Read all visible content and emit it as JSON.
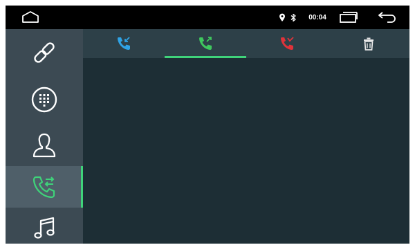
{
  "status_bar": {
    "time": "00:04",
    "icons": [
      "home-icon",
      "location-pin-icon",
      "bluetooth-icon",
      "recent-apps-icon",
      "back-icon"
    ]
  },
  "sidebar": {
    "items": [
      {
        "icon": "link-icon",
        "active": false
      },
      {
        "icon": "dialpad-icon",
        "active": false
      },
      {
        "icon": "contacts-icon",
        "active": false
      },
      {
        "icon": "call-log-icon",
        "active": true
      },
      {
        "icon": "music-icon",
        "active": false
      }
    ]
  },
  "tabs": [
    {
      "icon": "incoming-call-icon",
      "color": "#2fa3e6",
      "selected": false
    },
    {
      "icon": "outgoing-call-icon",
      "color": "#3fc85e",
      "selected": true
    },
    {
      "icon": "missed-call-icon",
      "color": "#e0333a",
      "selected": false
    },
    {
      "icon": "trash-icon",
      "color": "#e8e8e8",
      "selected": false
    }
  ],
  "colors": {
    "accent": "#3fd37a",
    "status_bar": "#000000",
    "sidebar": "#3c4a53",
    "tab_bar": "#2d4048",
    "content": "#1d2e35"
  }
}
